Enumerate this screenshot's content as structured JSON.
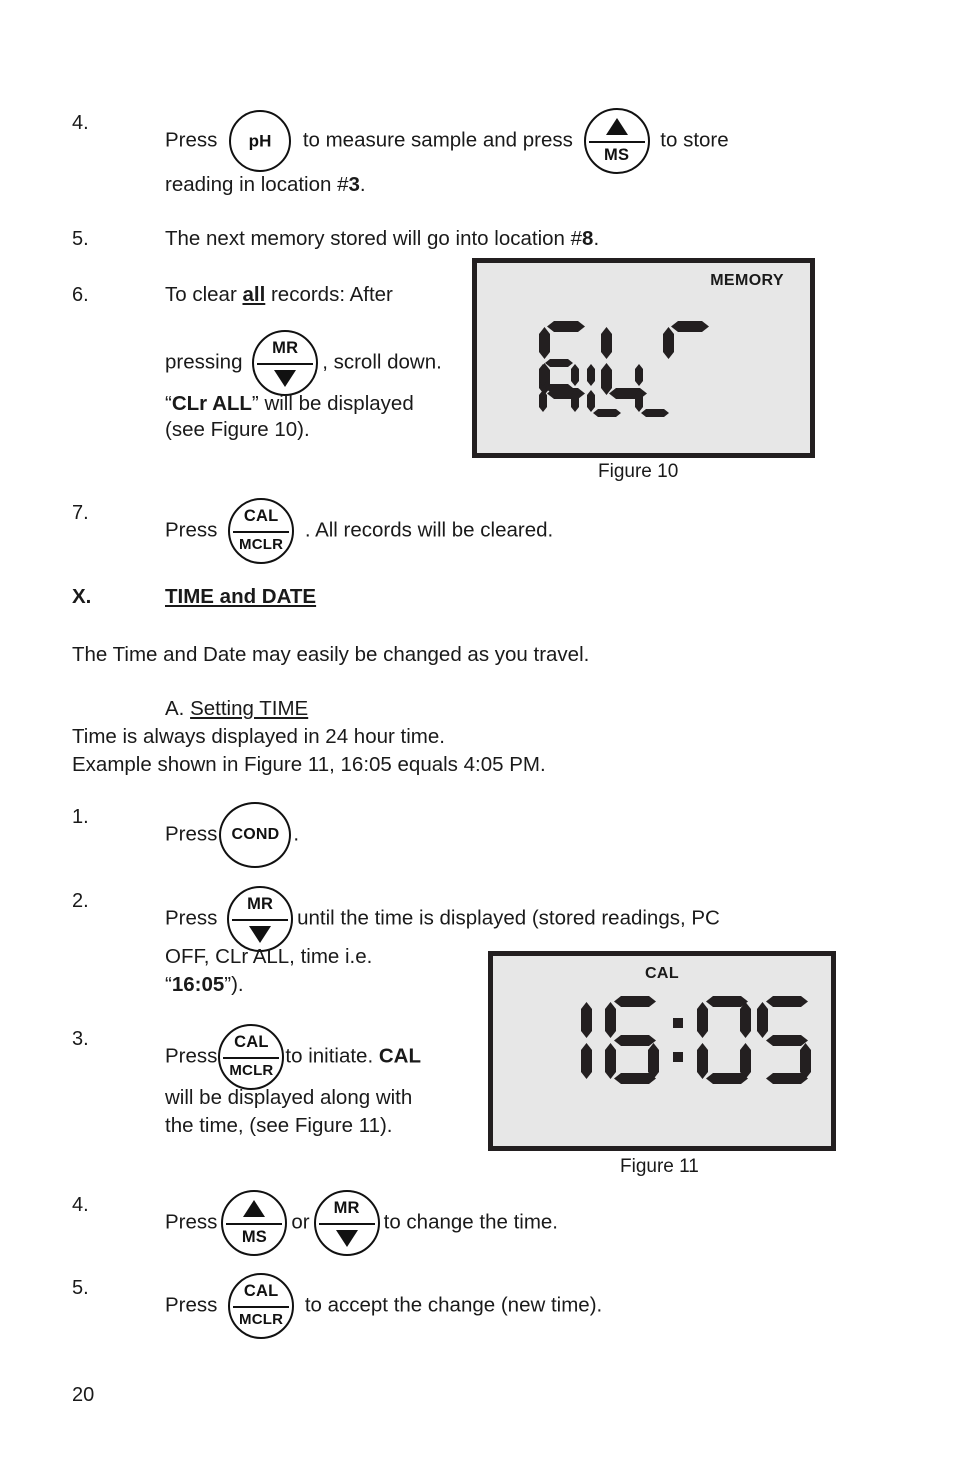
{
  "page": {
    "number": "20"
  },
  "buttons": {
    "ph": {
      "label": "pH"
    },
    "cond": {
      "label": "COND"
    },
    "ms": {
      "top_icon": "triangle-up-icon",
      "bottom_label": "MS"
    },
    "mr": {
      "top_label": "MR",
      "bottom_icon": "triangle-down-icon"
    },
    "cal": {
      "top_label": "CAL",
      "bottom_label": "MCLR"
    }
  },
  "memory_steps": {
    "step4": {
      "number": "4.",
      "part1": "Press",
      "part2": "to measure sample and press",
      "part3": "to store",
      "line2_pre": "reading in location #",
      "line2_bold": "3",
      "line2_post": "."
    },
    "step5": {
      "number": "5.",
      "pre": "The next memory stored will go into location #",
      "bold": "8",
      "post": "."
    },
    "step6": {
      "number": "6.",
      "line1_pre": "To clear ",
      "line1_bold_ul": "all",
      "line1_post": " records: After",
      "line2_pre": "pressing",
      "line2_post": ", scroll down.",
      "line3_open_quote": "“",
      "line3_bold": "CLr ALL",
      "line3_close": "” will be displayed",
      "line4": "(see Figure 10)."
    },
    "step7": {
      "number": "7.",
      "pre": "Press",
      "post": ". All records will be cleared."
    }
  },
  "figure10": {
    "annunciator": "MEMORY",
    "lcd_line1": "CLr",
    "lcd_line2": "ALL",
    "caption": "Figure 10"
  },
  "section": {
    "roman": "X.",
    "title": "TIME and DATE",
    "intro": "The Time and Date may easily be changed as you travel.",
    "sub_label": "A.",
    "sub_title": "Setting TIME",
    "note_line1": "Time is always displayed in 24 hour time.",
    "note_line2": "Example shown in Figure 11, 16:05 equals 4:05 PM."
  },
  "time_steps": {
    "step1": {
      "number": "1.",
      "pre": "Press",
      "post": "."
    },
    "step2": {
      "number": "2.",
      "pre": "Press",
      "post": "until the time is displayed (stored readings, PC",
      "line2": "OFF, CLr  ALL,  time i.e.",
      "line3_open_quote": "“",
      "line3_bold": "16:05",
      "line3_close": "”)."
    },
    "step3": {
      "number": "3.",
      "pre": "Press",
      "mid": "to initiate. ",
      "bold": "CAL",
      "line2": "will be displayed along with",
      "line3": "the time, (see Figure 11)."
    },
    "step4": {
      "number": "4.",
      "pre": "Press",
      "mid": "or",
      "post": "to change the time."
    },
    "step5": {
      "number": "5.",
      "pre": "Press",
      "post": "to accept the change (new time)."
    }
  },
  "figure11": {
    "annunciator": "CAL",
    "lcd_time": "16:05",
    "caption": "Figure 11"
  },
  "colors": {
    "ink": "#1a1a1a",
    "lcd_background": "#e7e7e7",
    "lcd_segment": "#231f20"
  }
}
